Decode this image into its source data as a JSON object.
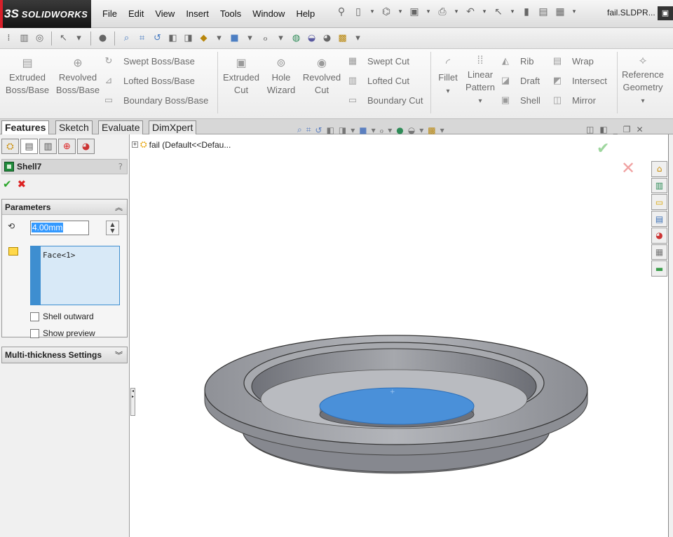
{
  "app": {
    "brand_prefix": "3S",
    "brand_name": "SOLIDWORKS",
    "filename": "fail.SLDPR..."
  },
  "menu": [
    "File",
    "Edit",
    "View",
    "Insert",
    "Tools",
    "Window",
    "Help"
  ],
  "ribbon": {
    "extruded_boss": {
      "l1": "Extruded",
      "l2": "Boss/Base"
    },
    "revolved_boss": {
      "l1": "Revolved",
      "l2": "Boss/Base"
    },
    "swept_boss": "Swept Boss/Base",
    "lofted_boss": "Lofted Boss/Base",
    "boundary_boss": "Boundary Boss/Base",
    "extruded_cut": {
      "l1": "Extruded",
      "l2": "Cut"
    },
    "hole_wizard": {
      "l1": "Hole",
      "l2": "Wizard"
    },
    "revolved_cut": {
      "l1": "Revolved",
      "l2": "Cut"
    },
    "swept_cut": "Swept Cut",
    "lofted_cut": "Lofted Cut",
    "boundary_cut": "Boundary Cut",
    "fillet": "Fillet",
    "linear_pattern": {
      "l1": "Linear",
      "l2": "Pattern"
    },
    "rib": "Rib",
    "draft": "Draft",
    "shell": "Shell",
    "wrap": "Wrap",
    "intersect": "Intersect",
    "mirror": "Mirror",
    "reference_geometry": {
      "l1": "Reference",
      "l2": "Geometry"
    }
  },
  "tabs": [
    "Features",
    "Sketch",
    "Evaluate",
    "DimXpert"
  ],
  "property_manager": {
    "title": "Shell7",
    "help": "?",
    "parameters": {
      "header": "Parameters",
      "thickness": "4.00mm",
      "faces": [
        "Face<1>"
      ],
      "shell_outward": "Shell outward",
      "show_preview": "Show preview"
    },
    "multi_thickness": {
      "header": "Multi-thickness Settings"
    }
  },
  "tree": {
    "root_label": "fail  (Default<<Defau..."
  },
  "colors": {
    "selected_face": "#4a90d9",
    "model_body": "#9a9ca3",
    "ok": "#2aa52a",
    "cancel": "#dd2222"
  }
}
